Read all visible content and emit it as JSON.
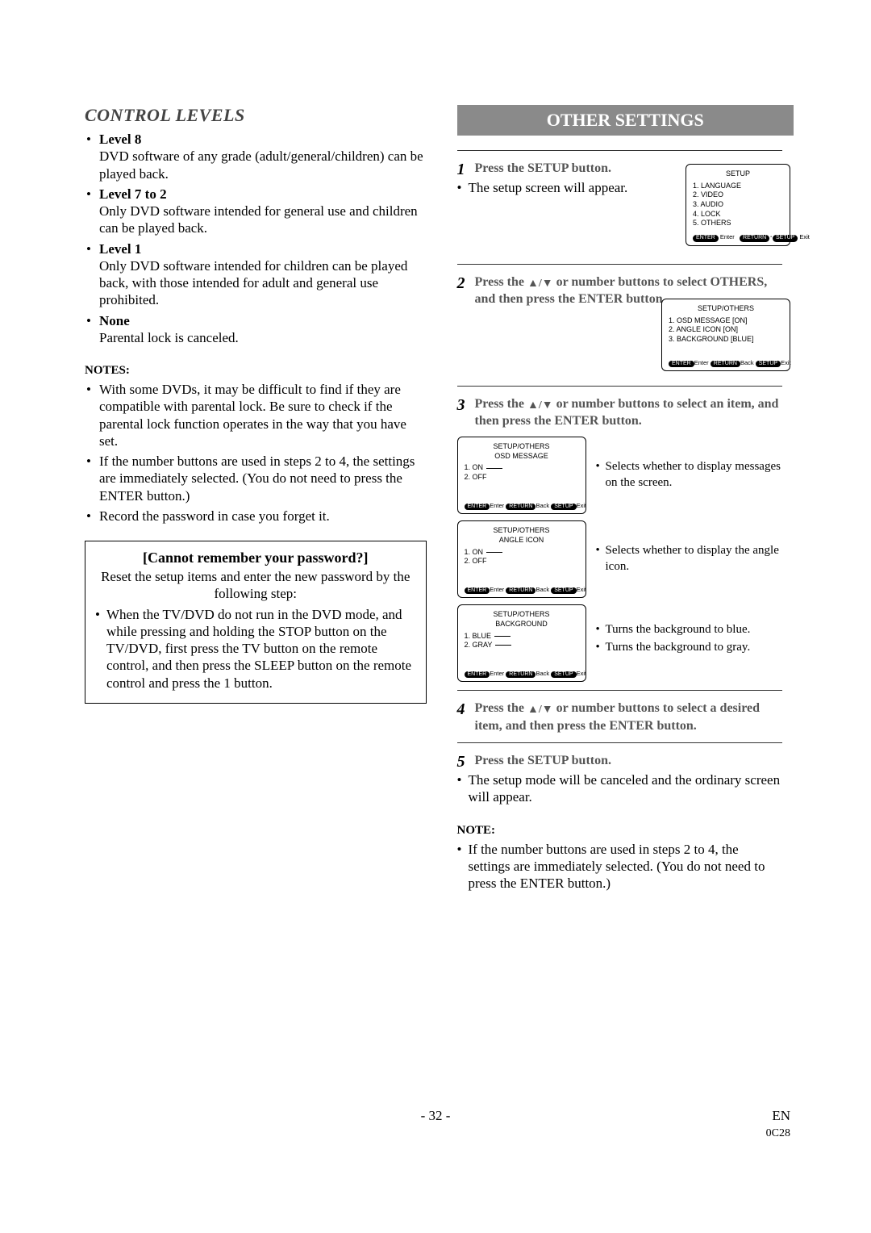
{
  "left": {
    "heading": "CONTROL LEVELS",
    "levels": [
      {
        "title": "Level 8",
        "desc": "DVD software of any grade (adult/general/children) can be played back."
      },
      {
        "title": "Level 7 to 2",
        "desc": "Only DVD software intended for general use and children can be played back."
      },
      {
        "title": "Level 1",
        "desc": "Only DVD software intended for children can be played back, with those intended for adult and general use prohibited."
      },
      {
        "title": "None",
        "desc": "Parental lock is canceled."
      }
    ],
    "notes_h": "NOTES:",
    "notes": [
      "With some DVDs, it may be difficult to find if they are compatible with parental lock. Be sure to check if the parental lock function operates in the way that you have set.",
      "If the number buttons are used in steps 2 to 4, the settings are immediately selected. (You do not need to press the ENTER button.)",
      "Record the password in case you forget it."
    ],
    "pw_title": "[Cannot remember your password?]",
    "pw_sub": "Reset the setup items and enter the new password by the following step:",
    "pw_step": "When the TV/DVD do not run in the DVD mode, and while pressing and holding the STOP button on the TV/DVD, first press the TV button on the remote control, and then press the SLEEP button on the remote control and press the 1 button."
  },
  "right": {
    "banner": "OTHER SETTINGS",
    "step1_head": "Press the SETUP button.",
    "step1_body": "The setup screen will appear.",
    "osd_setup": {
      "title": "SETUP",
      "items": [
        "1. LANGUAGE",
        "2. VIDEO",
        "3. AUDIO",
        "4. LOCK",
        "5. OTHERS"
      ],
      "foot_enter": "ENTER",
      "foot_enter_t": "Enter",
      "foot_return": "RETURN",
      "foot_setup": "SETUP",
      "foot_exit": "Exit"
    },
    "step2_head_a": "Press the ",
    "step2_head_b": " or number buttons to select OTHERS, and then press the ENTER button.",
    "osd_others": {
      "title": "SETUP/OTHERS",
      "items": [
        "1. OSD MESSAGE [ON]",
        "2. ANGLE ICON     [ON]",
        "3. BACKGROUND  [BLUE]"
      ]
    },
    "step3_head_a": "Press the ",
    "step3_head_b": " or number buttons to select an item, and then press the ENTER button.",
    "osd_a_title1": "SETUP/OTHERS",
    "osd_a_title2": "OSD MESSAGE",
    "osd_a_items": [
      "1. ON",
      "2. OFF"
    ],
    "osd_a_note": "Selects whether to display messages on the screen.",
    "osd_b_title1": "SETUP/OTHERS",
    "osd_b_title2": "ANGLE ICON",
    "osd_b_items": [
      "1. ON",
      "2. OFF"
    ],
    "osd_b_note": "Selects whether to display the angle icon.",
    "osd_c_title1": "SETUP/OTHERS",
    "osd_c_title2": "BACKGROUND",
    "osd_c_items": [
      "1. BLUE",
      "2. GRAY"
    ],
    "osd_c_note1": "Turns the background to blue.",
    "osd_c_note2": "Turns the background to gray.",
    "step4_head_a": "Press the ",
    "step4_head_b": " or number buttons to select a desired item, and then press the ENTER button.",
    "step5_head": "Press the SETUP button.",
    "step5_body": "The setup mode will be canceled and the ordinary screen will appear.",
    "note_h": "NOTE:",
    "note_body": "If the number buttons are used in steps 2 to 4, the settings are immediately selected. (You do not need to press the ENTER button.)",
    "foot_back": "Back"
  },
  "footer": {
    "page": "- 32 -",
    "lang": "EN",
    "code": "0C28"
  }
}
